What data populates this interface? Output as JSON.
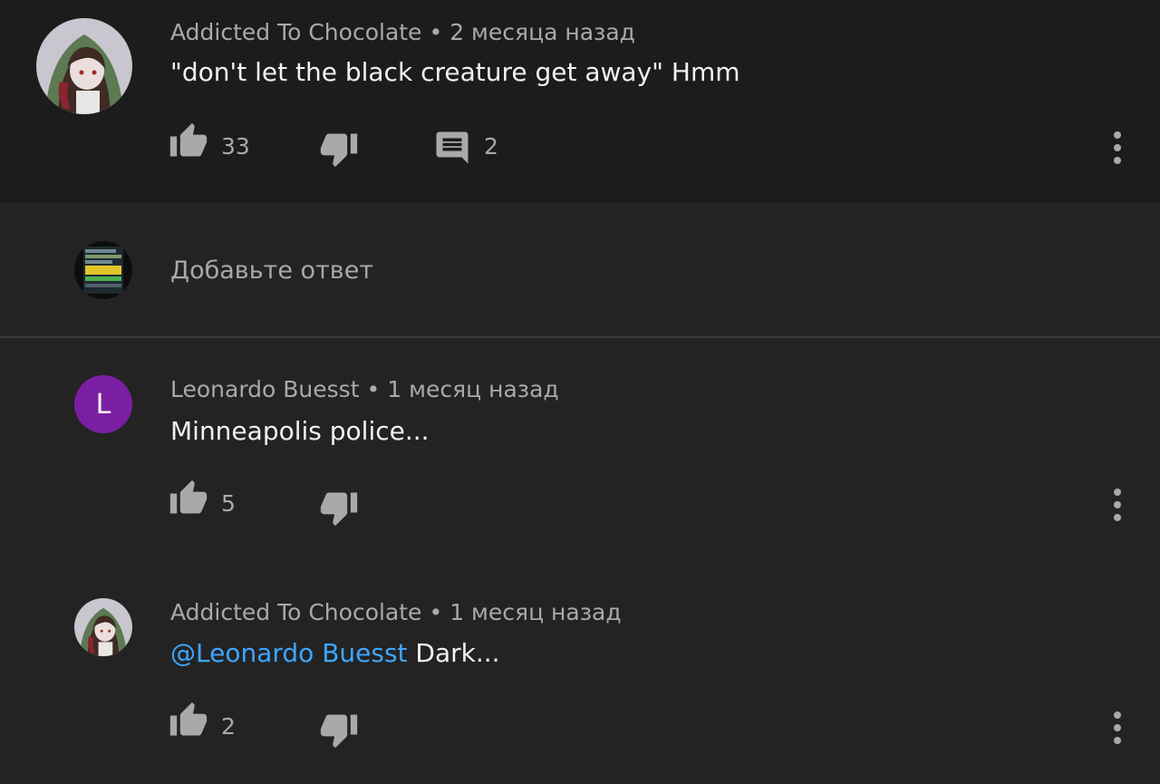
{
  "colors": {
    "background": "#232323",
    "top_comment_bg": "#1c1c1c",
    "text_primary": "#f1f1f1",
    "text_secondary": "#a9a9a9",
    "mention": "#3ea6ff",
    "letter_avatar": "#7b1fa2"
  },
  "comment": {
    "author": "Addicted To Chocolate",
    "separator": "•",
    "time": "2 месяца назад",
    "text": "\"don't let the black creature get away\" Hmm",
    "likes": "33",
    "replies_count": "2",
    "icons": {
      "like": "thumb-up-icon",
      "dislike": "thumb-down-icon",
      "reply": "comment-icon",
      "more": "more-vert-icon"
    }
  },
  "reply_box": {
    "placeholder": "Добавьте ответ"
  },
  "replies": [
    {
      "author": "Leonardo Buesst",
      "separator": "•",
      "time": "1 месяц назад",
      "avatar_letter": "L",
      "text": "Minneapolis police...",
      "likes": "5"
    },
    {
      "author": "Addicted To Chocolate",
      "separator": "•",
      "time": "1 месяц назад",
      "mention": "@Leonardo Buesst",
      "text": " Dark...",
      "likes": "2"
    }
  ]
}
